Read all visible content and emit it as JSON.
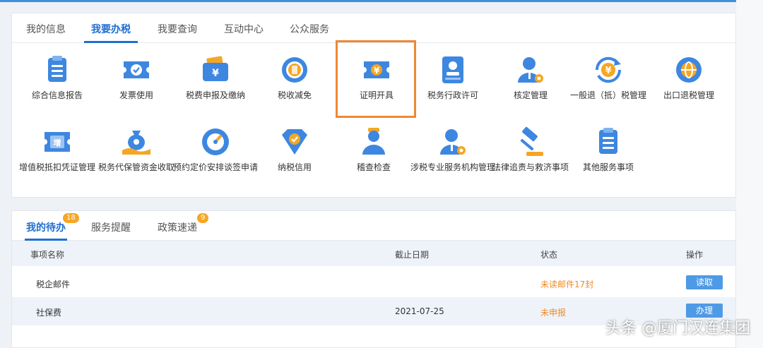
{
  "top_tabs": [
    {
      "label": "我的信息"
    },
    {
      "label": "我要办税"
    },
    {
      "label": "我要查询"
    },
    {
      "label": "互动中心"
    },
    {
      "label": "公众服务"
    }
  ],
  "services": [
    {
      "label": "综合信息报告",
      "icon": "report-icon"
    },
    {
      "label": "发票使用",
      "icon": "invoice-icon"
    },
    {
      "label": "税费申报及缴纳",
      "icon": "wallet-yen-icon"
    },
    {
      "label": "税收减免",
      "icon": "coin-stack-icon"
    },
    {
      "label": "证明开具",
      "icon": "certificate-yen-icon"
    },
    {
      "label": "税务行政许可",
      "icon": "license-stamp-icon"
    },
    {
      "label": "核定管理",
      "icon": "user-gear-icon"
    },
    {
      "label": "一般退（抵）税管理",
      "icon": "refund-yen-icon"
    },
    {
      "label": "出口退税管理",
      "icon": "globe-icon"
    },
    {
      "label": "增值税抵扣凭证管理",
      "icon": "vat-ticket-icon"
    },
    {
      "label": "税务代保管资金收取",
      "icon": "money-bag-hand-icon"
    },
    {
      "label": "预约定价安排谈签申请",
      "icon": "gauge-icon"
    },
    {
      "label": "纳税信用",
      "icon": "diamond-check-icon"
    },
    {
      "label": "稽查检查",
      "icon": "inspector-icon"
    },
    {
      "label": "涉税专业服务机构管理",
      "icon": "user-gear-2-icon"
    },
    {
      "label": "法律追责与救济事项",
      "icon": "gavel-icon"
    },
    {
      "label": "其他服务事项",
      "icon": "clipboard-icon"
    }
  ],
  "bottom_tabs": [
    {
      "label": "我的待办",
      "badge": "18"
    },
    {
      "label": "服务提醒"
    },
    {
      "label": "政策速递",
      "badge": "9"
    }
  ],
  "table": {
    "headers": [
      "事项名称",
      "截止日期",
      "状态",
      "操作"
    ],
    "rows": [
      {
        "name": "税企邮件",
        "date": "",
        "status": "未读邮件17封",
        "action": "读取"
      },
      {
        "name": "社保费",
        "date": "2021-07-25",
        "status": "未申报",
        "action": "办理"
      }
    ]
  },
  "watermark": "头条 @厦门汉连集团",
  "colors": {
    "accent": "#1f6fd1",
    "highlight_box": "#ee8833",
    "warning_text": "#f08a24",
    "badge": "#f5a623",
    "button": "#4f9ae6"
  }
}
